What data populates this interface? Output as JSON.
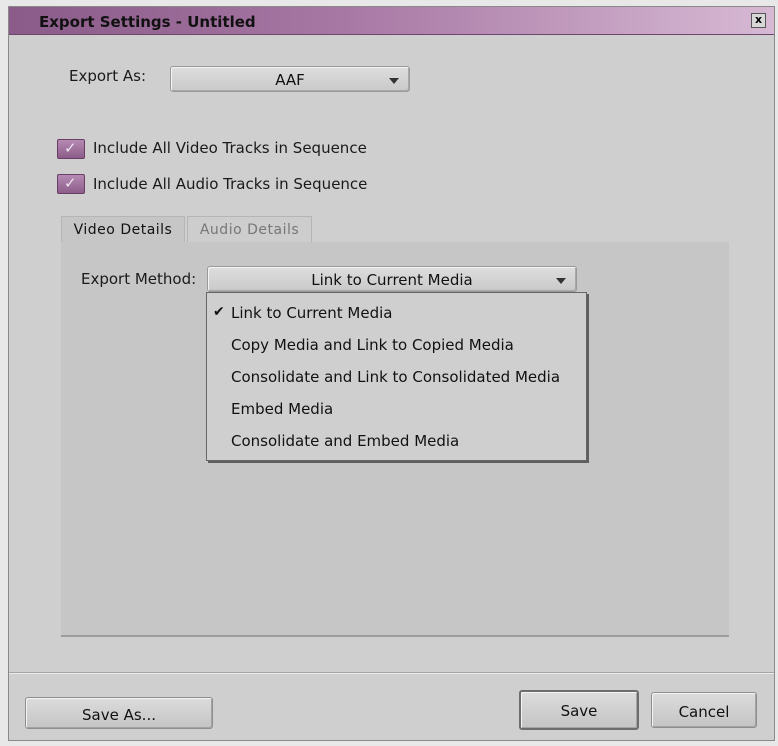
{
  "window": {
    "title": "Export Settings - Untitled",
    "close_glyph": "x"
  },
  "export_as": {
    "label": "Export As:",
    "value": "AAF"
  },
  "checkboxes": [
    {
      "label": "Include All Video Tracks in Sequence",
      "checked": true
    },
    {
      "label": "Include All Audio Tracks in Sequence",
      "checked": true
    }
  ],
  "tabs": [
    {
      "label": "Video Details",
      "active": true
    },
    {
      "label": "Audio Details",
      "active": false
    }
  ],
  "export_method": {
    "label": "Export Method:",
    "value": "Link to Current Media",
    "options": [
      {
        "label": "Link to Current Media",
        "checked": true
      },
      {
        "label": "Copy Media and Link to Copied Media",
        "checked": false
      },
      {
        "label": "Consolidate and Link to Consolidated Media",
        "checked": false
      },
      {
        "label": "Embed Media",
        "checked": false
      },
      {
        "label": "Consolidate and Embed Media",
        "checked": false
      }
    ]
  },
  "buttons": {
    "save_as": "Save As...",
    "save": "Save",
    "cancel": "Cancel"
  },
  "colors": {
    "checkbox": "#9c6b99",
    "titlebar_start": "#8a5a88",
    "titlebar_end": "#d7b9d4"
  }
}
